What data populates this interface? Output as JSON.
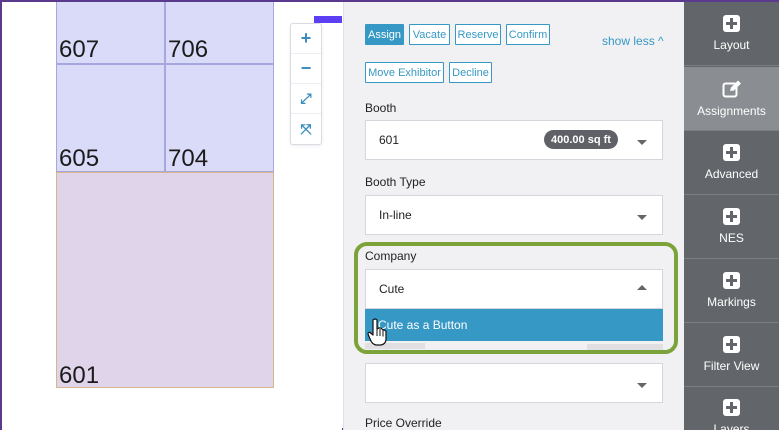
{
  "floorplan": {
    "booths": [
      "607",
      "706",
      "605",
      "704",
      "601"
    ]
  },
  "zoom": {
    "zoom_in": "+",
    "zoom_out": "−",
    "expand": "⤢",
    "fit": "⤧"
  },
  "actions": {
    "assign": "Assign",
    "vacate": "Vacate",
    "reserve": "Reserve",
    "confirm": "Confirm",
    "show_less": "show less ^",
    "move_exhibitor": "Move Exhibitor",
    "decline": "Decline"
  },
  "form": {
    "booth_label": "Booth",
    "booth_value": "601",
    "booth_size": "400.00 sq ft",
    "booth_type_label": "Booth Type",
    "booth_type_value": "In-line",
    "company_label": "Company",
    "company_value": "Cute",
    "company_option": "Cute as a Button",
    "price_override_label": "Price Override"
  },
  "sidebar": {
    "items": [
      {
        "label": "Layout"
      },
      {
        "label": "Assignments"
      },
      {
        "label": "Advanced"
      },
      {
        "label": "NES"
      },
      {
        "label": "Markings"
      },
      {
        "label": "Filter View"
      },
      {
        "label": "Layers"
      }
    ]
  },
  "colors": {
    "accent": "#3698c4",
    "highlight": "#7ca33a",
    "sidebar": "#626569",
    "booth_lavender": "#dadaf9",
    "booth_pink": "#e0d4ea"
  }
}
